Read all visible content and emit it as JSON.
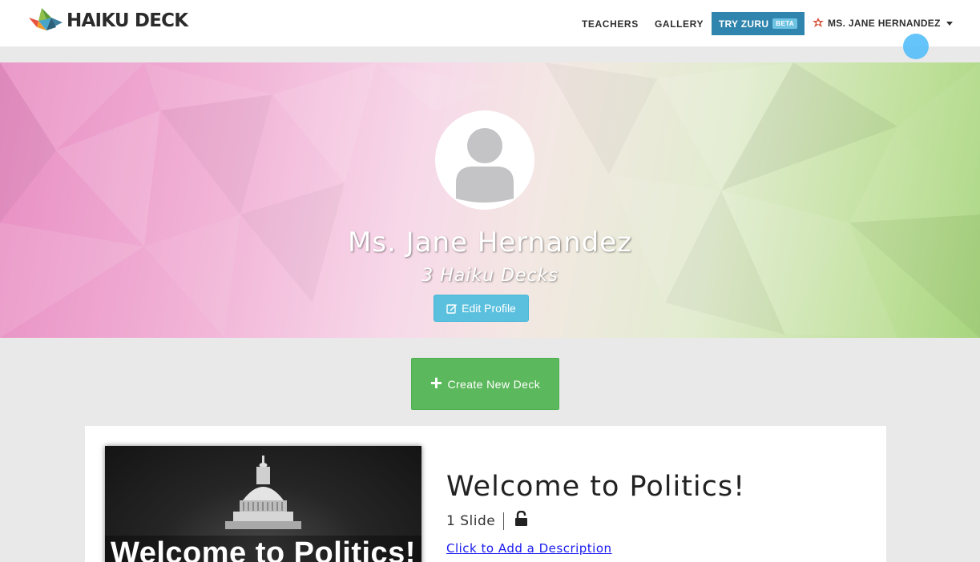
{
  "navbar": {
    "logo_text": "HAIKU DECK",
    "links": {
      "teachers": "TEACHERS",
      "gallery": "GALLERY"
    },
    "try_zuru": {
      "label": "TRY ZURU",
      "badge": "BETA"
    },
    "user_menu": {
      "label": "MS. JANE HERNANDEZ",
      "icon": "user-gear-icon"
    }
  },
  "profile": {
    "name": "Ms. Jane Hernandez",
    "deck_count": "3 Haiku Decks",
    "edit_button": "Edit Profile"
  },
  "create_deck": {
    "label": "Create New Deck",
    "icon": "+"
  },
  "decks": [
    {
      "thumbnail_title": "Welcome to Politics!",
      "title": "Welcome to Politics!",
      "slides": "1 Slide",
      "privacy_icon": "unlock-icon",
      "description_link": "Click to Add a Description"
    }
  ],
  "colors": {
    "accent_blue": "#2f85ad",
    "beta_badge": "#6ec3e3",
    "edit_button": "#5bc0de",
    "create_button": "#5cb85c",
    "cursor_highlight": "#54bef8"
  }
}
